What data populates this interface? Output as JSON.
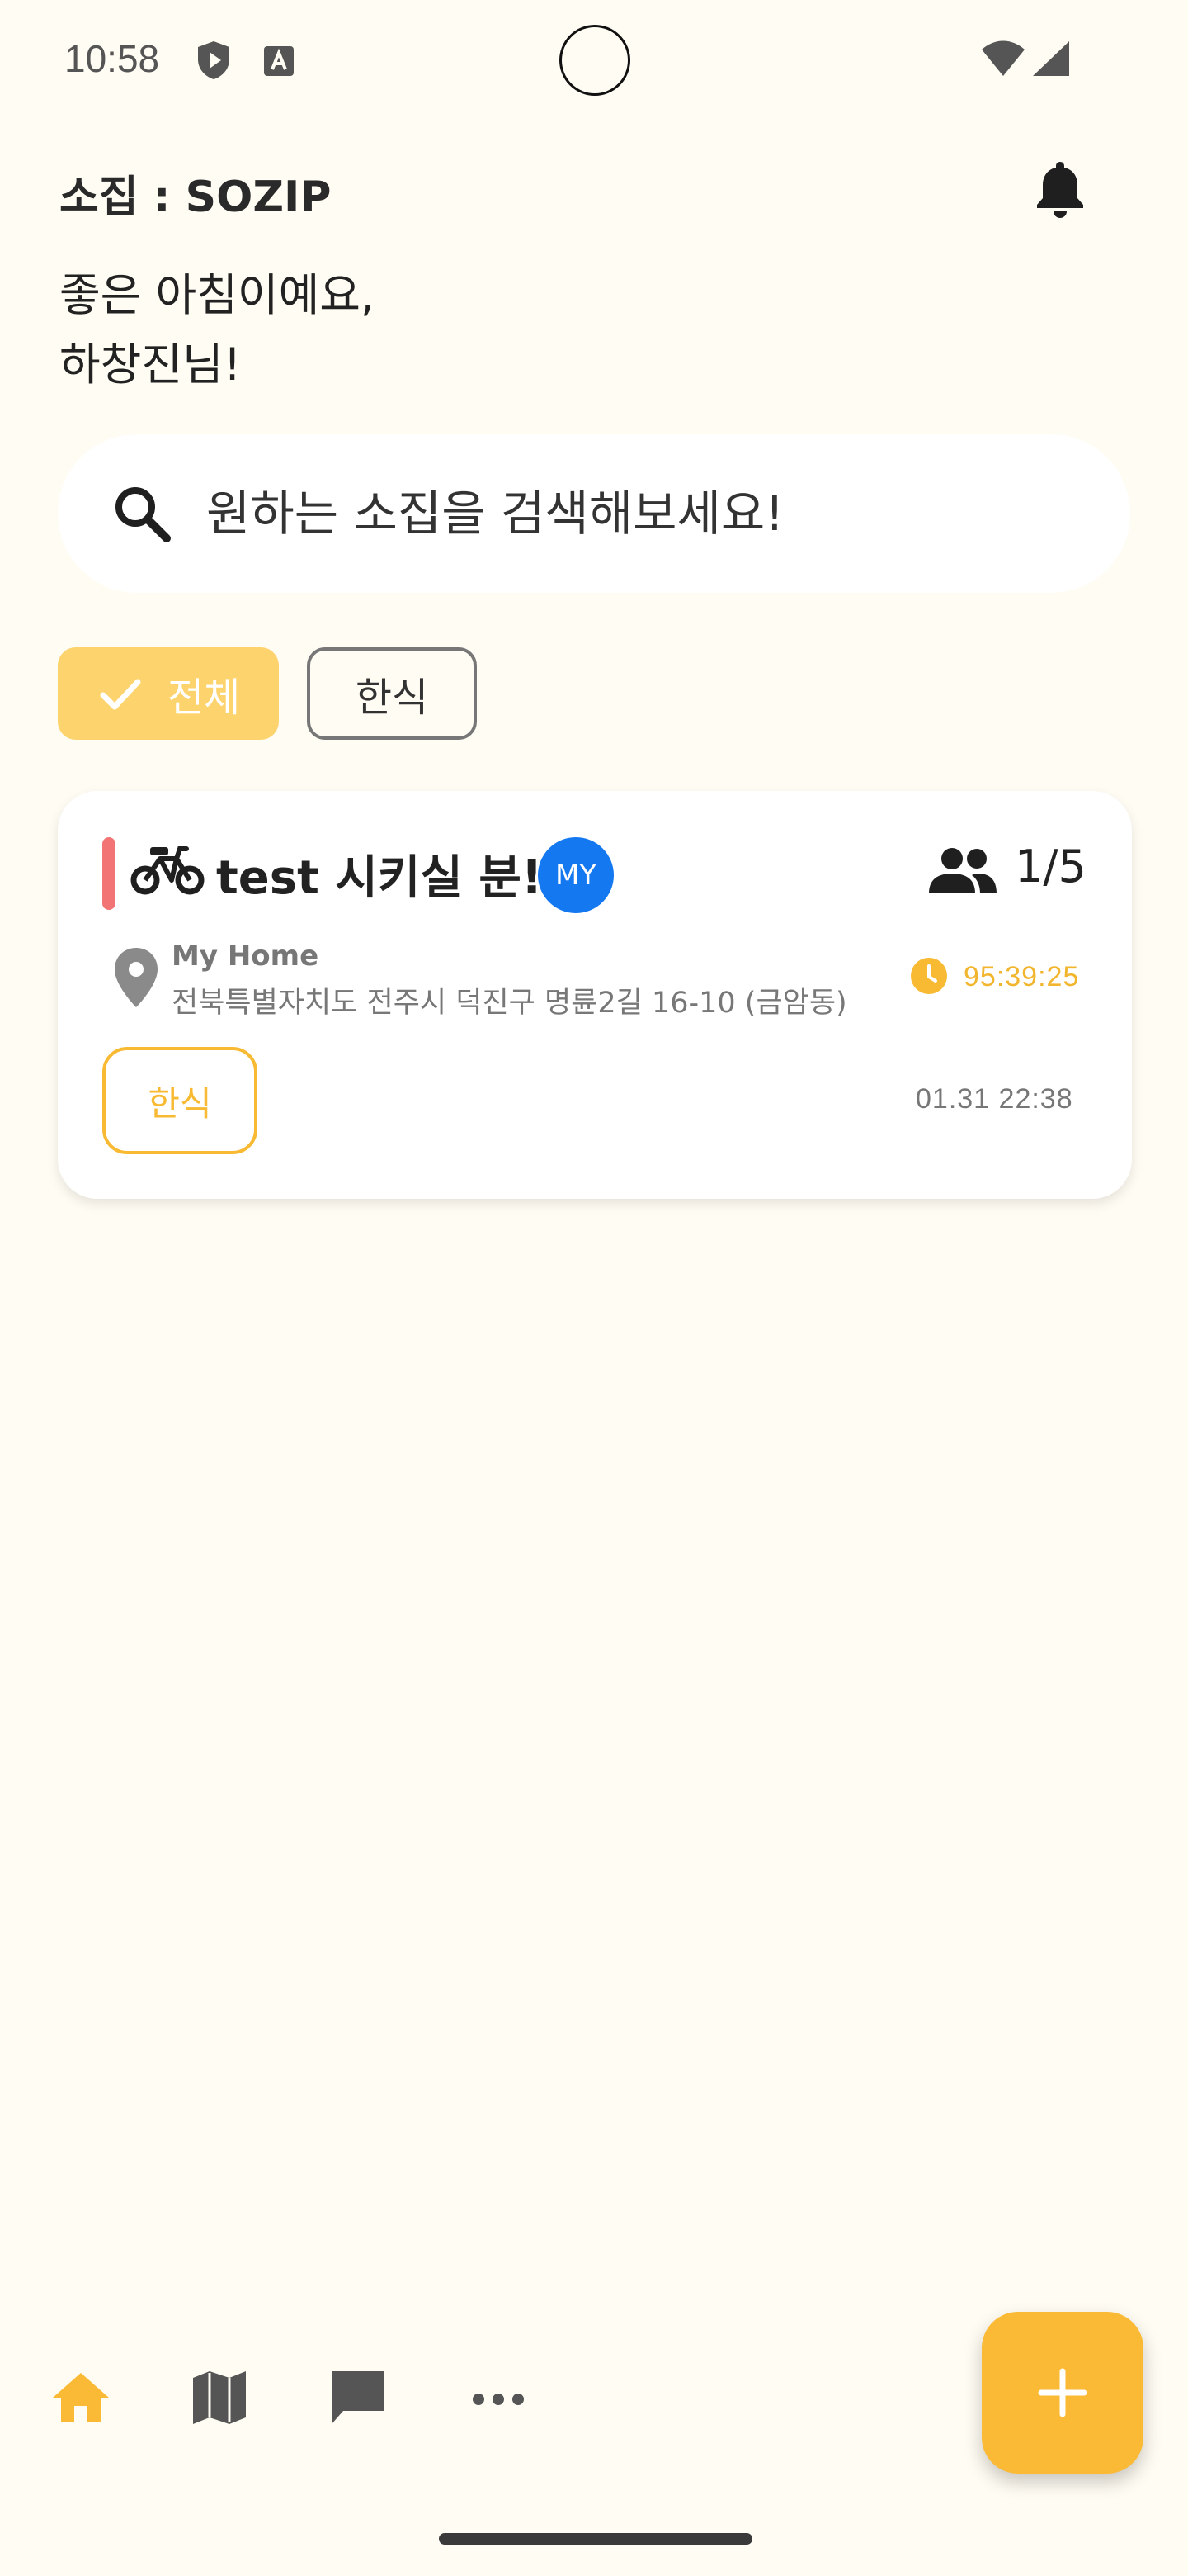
{
  "status_bar": {
    "time": "10:58",
    "icons": [
      "shield-play-icon",
      "a-text-icon",
      "wifi-icon",
      "signal-icon"
    ]
  },
  "header": {
    "title": "소집 : SOZIP",
    "notification_icon": "bell-icon"
  },
  "greeting": {
    "line1": "좋은 아침이예요,",
    "line2": "하창진님!"
  },
  "search": {
    "placeholder": "원하는 소집을 검색해보세요!",
    "value": "",
    "icon": "search-icon"
  },
  "filters": {
    "chips": [
      {
        "label": "전체",
        "selected": true
      },
      {
        "label": "한식",
        "selected": false
      }
    ]
  },
  "cards": [
    {
      "title": "test 시키실 분!",
      "badge": "MY",
      "participants": "1/5",
      "place_name": "My Home",
      "address": "전북특별자치도 전주시 덕진구 명륜2길 16-10 (금암동)",
      "timer": "95:39:25",
      "category": "한식",
      "created_at": "01.31 22:38",
      "accent_color": "#F27474"
    }
  ],
  "bottom_nav": {
    "items": [
      "home-icon",
      "map-icon",
      "chat-icon",
      "more-icon"
    ],
    "active": "home-icon",
    "fab_icon": "plus-icon"
  },
  "colors": {
    "background": "#FFFCF3",
    "primary": "#FBBA35",
    "chip_selected": "#FDD36E",
    "badge_blue": "#1478F0",
    "text_muted": "#777777"
  }
}
